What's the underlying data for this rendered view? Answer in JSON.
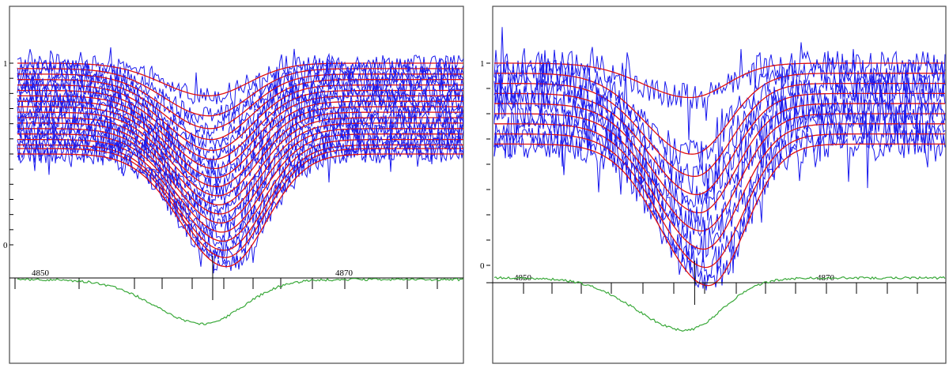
{
  "chart_data": [
    {
      "type": "line",
      "panel": "left",
      "title": "",
      "xlabel": "",
      "ylabel": "",
      "upper_yticks": [
        "1",
        "0"
      ],
      "lower_xticks": [
        4850,
        4870
      ],
      "line_center_wavelength": 4861.3,
      "xlim": [
        4848,
        4876
      ],
      "ylim": [
        0,
        1
      ],
      "series": [
        {
          "values": {
            "level": 1.0,
            "depth": 0.18
          }
        },
        {
          "values": {
            "level": 0.97,
            "depth": 0.26
          }
        },
        {
          "values": {
            "level": 0.94,
            "depth": 0.3
          }
        },
        {
          "values": {
            "level": 0.91,
            "depth": 0.33
          }
        },
        {
          "values": {
            "level": 0.88,
            "depth": 0.36
          }
        },
        {
          "values": {
            "level": 0.85,
            "depth": 0.38
          }
        },
        {
          "values": {
            "level": 0.82,
            "depth": 0.4
          }
        },
        {
          "values": {
            "level": 0.79,
            "depth": 0.42
          }
        },
        {
          "values": {
            "level": 0.76,
            "depth": 0.44
          }
        },
        {
          "values": {
            "level": 0.73,
            "depth": 0.46
          }
        },
        {
          "values": {
            "level": 0.7,
            "depth": 0.48
          }
        },
        {
          "values": {
            "level": 0.67,
            "depth": 0.5
          }
        },
        {
          "values": {
            "level": 0.64,
            "depth": 0.52
          }
        },
        {
          "values": {
            "level": 0.61,
            "depth": 0.54
          }
        },
        {
          "values": {
            "level": 0.58,
            "depth": 0.56
          }
        },
        {
          "values": {
            "level": 0.55,
            "depth": 0.58
          }
        },
        {
          "values": {
            "level": 0.53,
            "depth": 0.6
          }
        },
        {
          "values": {
            "level": 0.5,
            "depth": 0.62
          }
        }
      ],
      "average_profile": {
        "depth": 0.62
      }
    },
    {
      "type": "line",
      "panel": "right",
      "title": "",
      "xlabel": "",
      "ylabel": "",
      "upper_yticks": [
        "1",
        "0"
      ],
      "lower_xticks": [
        4850,
        4870
      ],
      "line_center_wavelength": 4861.3,
      "xlim": [
        4848,
        4876
      ],
      "ylim": [
        0,
        1
      ],
      "series": [
        {
          "values": {
            "level": 1.0,
            "depth": 0.17
          }
        },
        {
          "values": {
            "level": 0.95,
            "depth": 0.4
          }
        },
        {
          "values": {
            "level": 0.9,
            "depth": 0.46
          }
        },
        {
          "values": {
            "level": 0.85,
            "depth": 0.5
          }
        },
        {
          "values": {
            "level": 0.8,
            "depth": 0.54
          }
        },
        {
          "values": {
            "level": 0.75,
            "depth": 0.58
          }
        },
        {
          "values": {
            "level": 0.7,
            "depth": 0.62
          }
        },
        {
          "values": {
            "level": 0.65,
            "depth": 0.66
          }
        },
        {
          "values": {
            "level": 0.6,
            "depth": 0.7
          }
        }
      ],
      "average_profile": {
        "depth": 0.6
      }
    }
  ],
  "colors": {
    "observed": "#1a1aee",
    "fit": "#e01010",
    "average": "#3aa93a"
  }
}
